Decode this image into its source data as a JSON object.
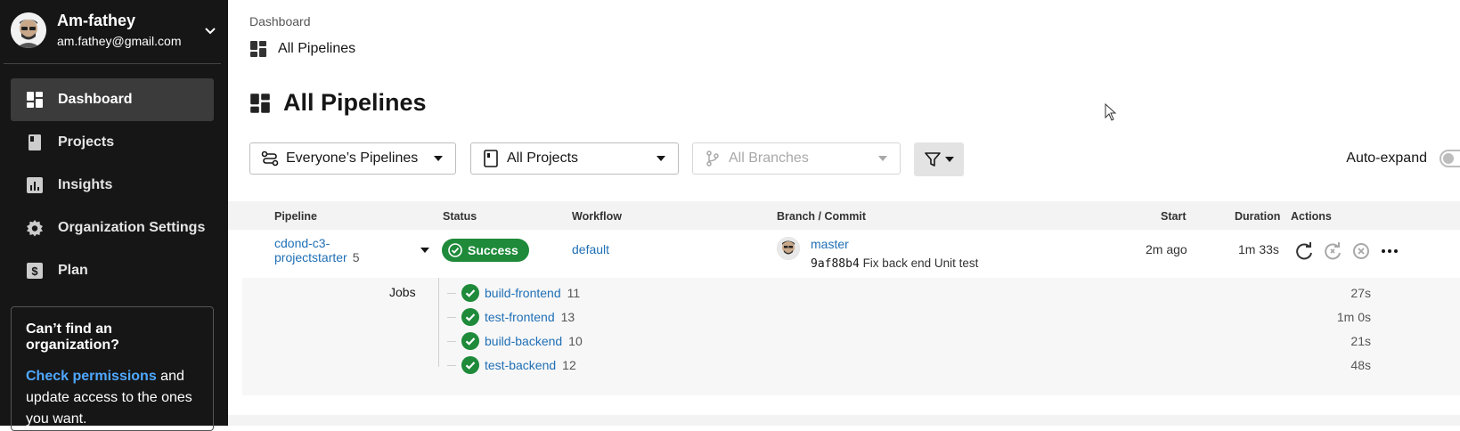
{
  "user": {
    "name": "Am-fathey",
    "email": "am.fathey@gmail.com"
  },
  "sidebar": {
    "items": [
      {
        "label": "Dashboard",
        "icon": "dashboard-icon",
        "active": true
      },
      {
        "label": "Projects",
        "icon": "projects-icon",
        "active": false
      },
      {
        "label": "Insights",
        "icon": "insights-icon",
        "active": false
      },
      {
        "label": "Organization Settings",
        "icon": "gear-icon",
        "active": false
      },
      {
        "label": "Plan",
        "icon": "dollar-icon",
        "active": false
      }
    ],
    "org_box": {
      "title": "Can’t find an organization?",
      "link": "Check permissions",
      "text": " and update access to the ones you want."
    }
  },
  "breadcrumb": {
    "parent": "Dashboard",
    "current": "All Pipelines"
  },
  "page": {
    "title": "All Pipelines"
  },
  "filters": {
    "pipelines": "Everyone’s Pipelines",
    "projects": "All Projects",
    "branches": "All Branches",
    "autoexpand_label": "Auto-expand"
  },
  "table": {
    "headers": {
      "pipeline": "Pipeline",
      "status": "Status",
      "workflow": "Workflow",
      "branch": "Branch / Commit",
      "start": "Start",
      "duration": "Duration",
      "actions": "Actions"
    },
    "row": {
      "pipeline": "cdond-c3-projectstarter",
      "number": "5",
      "status": "Success",
      "workflow": "default",
      "branch": "master",
      "commit_hash": "9af88b4",
      "commit_msg": "Fix back end Unit test",
      "start": "2m ago",
      "duration": "1m 33s"
    },
    "jobs_label": "Jobs",
    "jobs": [
      {
        "name": "build-frontend",
        "number": "11",
        "duration": "27s"
      },
      {
        "name": "test-frontend",
        "number": "13",
        "duration": "1m 0s"
      },
      {
        "name": "build-backend",
        "number": "10",
        "duration": "21s"
      },
      {
        "name": "test-backend",
        "number": "12",
        "duration": "48s"
      }
    ]
  },
  "colors": {
    "success": "#1e8a3a",
    "link": "#1f6fb5",
    "sidebar_bg": "#161616"
  }
}
